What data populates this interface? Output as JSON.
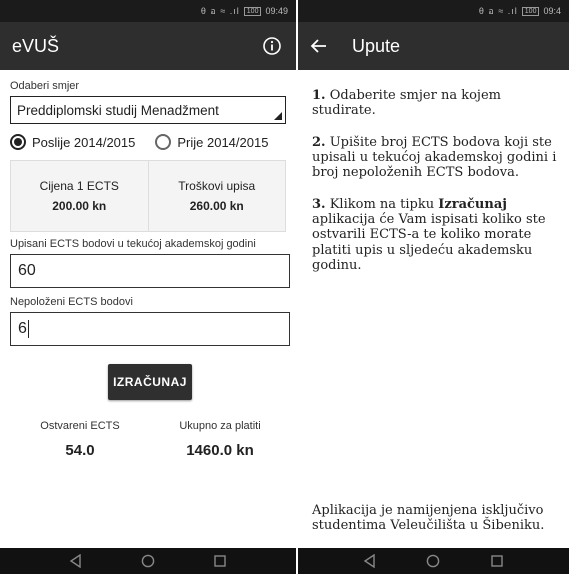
{
  "left": {
    "status": {
      "time": "09:49",
      "battery": "100",
      "icons": "θ อ ≈ .ıl"
    },
    "appbar": {
      "title": "eVUŠ"
    },
    "smjer": {
      "label": "Odaberi smjer",
      "value": "Preddiplomski studij Menadžment"
    },
    "radios": [
      {
        "label": "Poslije 2014/2015",
        "checked": true
      },
      {
        "label": "Prije 2014/2015",
        "checked": false
      }
    ],
    "prices": [
      {
        "label": "Cijena 1 ECTS",
        "value": "200.00 kn"
      },
      {
        "label": "Troškovi upisa",
        "value": "260.00 kn"
      }
    ],
    "upisani": {
      "label": "Upisani ECTS bodovi u tekućoj akademskoj godini",
      "value": "60"
    },
    "nepolozeni": {
      "label": "Nepoloženi ECTS bodovi",
      "value": "6"
    },
    "calc_button": "IZRAČUNAJ",
    "results": [
      {
        "label": "Ostvareni ECTS",
        "value": "54.0"
      },
      {
        "label": "Ukupno za platiti",
        "value": "1460.0 kn"
      }
    ]
  },
  "right": {
    "status": {
      "time": "09:4",
      "battery": "100",
      "icons": "θ อ ≈ .ıl"
    },
    "appbar": {
      "title": "Upute"
    },
    "steps": [
      {
        "num": "1.",
        "text": "Odaberite smjer na kojem studirate."
      },
      {
        "num": "2.",
        "text": "Upišite broj ECTS bodova koji ste upisali u tekućoj akademskoj godini i broj nepoloženih ECTS bodova."
      },
      {
        "num": "3.",
        "pre": "Klikom na tipku ",
        "bold": "Izračunaj",
        "text": " aplikacija će Vam ispisati koliko ste ostvarili ECTS-a te koliko morate platiti upis u sljedeću akademsku godinu."
      }
    ],
    "footer": "Aplikacija je namijenjena isključivo studentima Veleučilišta u Šibeniku."
  }
}
